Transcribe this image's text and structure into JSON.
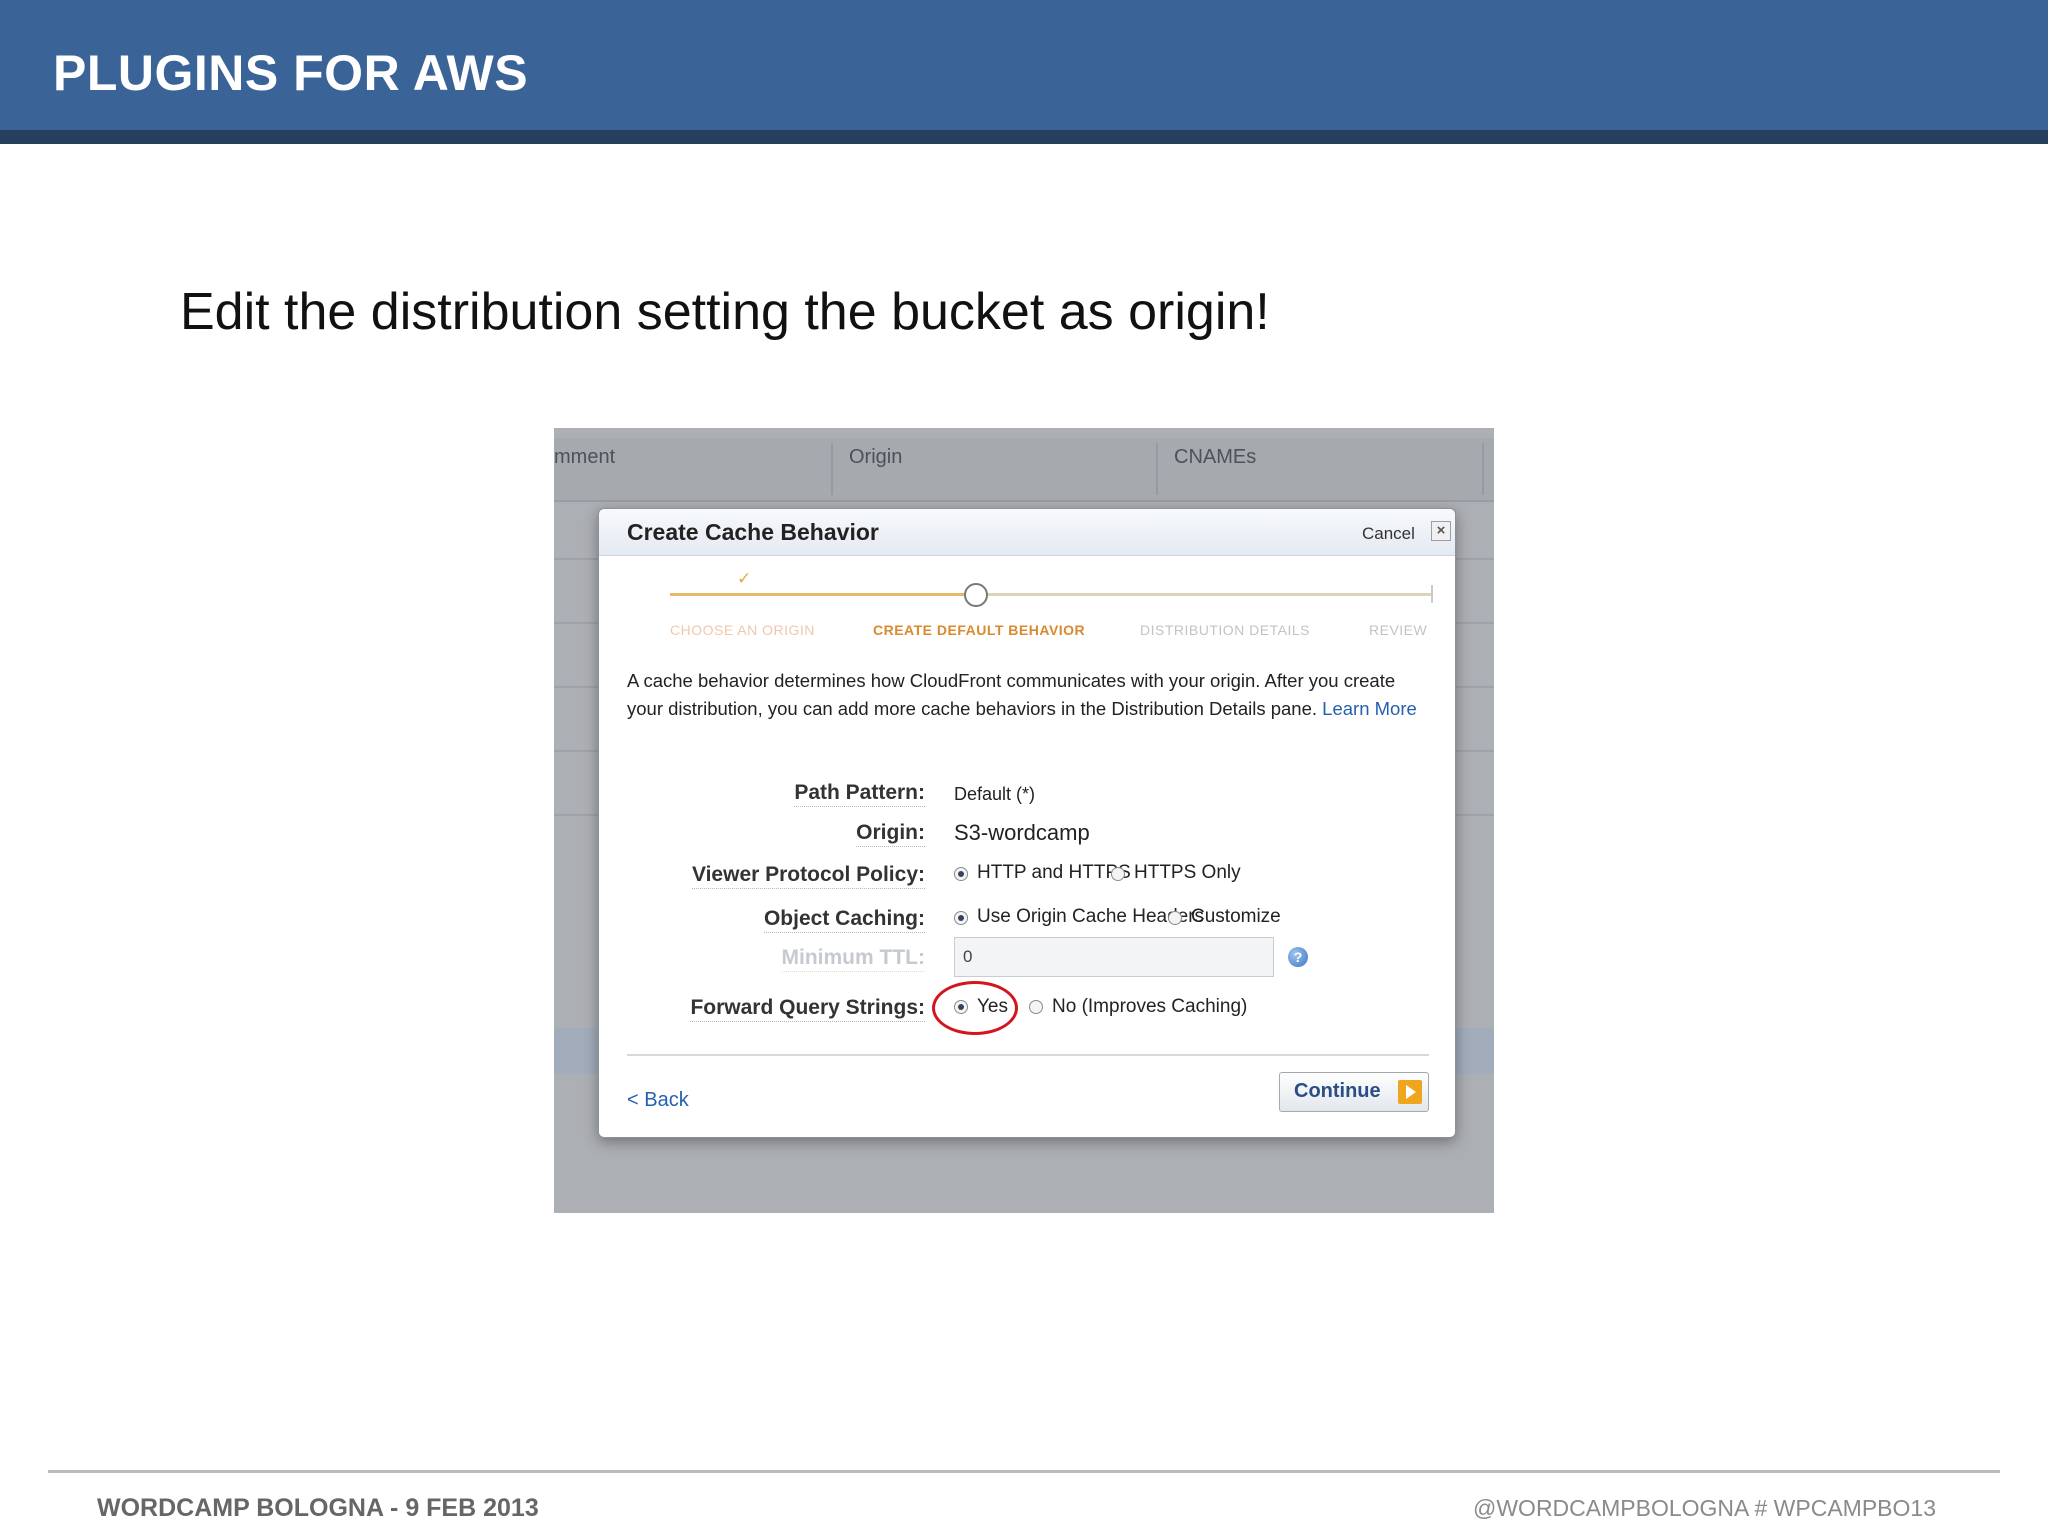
{
  "slide": {
    "title": "PLUGINS FOR AWS",
    "subtitle": "Edit the distribution setting the bucket as origin!",
    "footer_left": "WORDCAMP BOLOGNA - 9 FEB 2013",
    "footer_right": "@WORDCAMPBOLOGNA # WPCAMPBO13"
  },
  "background_table": {
    "columns": [
      "mment",
      "Origin",
      "CNAMEs"
    ]
  },
  "dialog": {
    "title": "Create Cache Behavior",
    "cancel_label": "Cancel",
    "close_icon": "×",
    "steps": [
      "CHOOSE AN ORIGIN",
      "CREATE DEFAULT BEHAVIOR",
      "DISTRIBUTION DETAILS",
      "REVIEW"
    ],
    "current_step": 2,
    "description": "A cache behavior determines how CloudFront communicates with your origin. After you create your distribution, you can add more cache behaviors in the Distribution Details pane.",
    "learn_more": "Learn More",
    "fields": {
      "path_pattern": {
        "label": "Path Pattern:",
        "value": "Default (*)"
      },
      "origin": {
        "label": "Origin:",
        "value": "S3-wordcamp"
      },
      "viewer_protocol_policy": {
        "label": "Viewer Protocol Policy:",
        "options": [
          "HTTP and HTTPS",
          "HTTPS Only"
        ],
        "selected": "HTTP and HTTPS"
      },
      "object_caching": {
        "label": "Object Caching:",
        "options": [
          "Use Origin Cache Headers",
          "Customize"
        ],
        "selected": "Use Origin Cache Headers"
      },
      "minimum_ttl": {
        "label": "Minimum TTL:",
        "value": "0",
        "help_icon": "?"
      },
      "forward_query_strings": {
        "label": "Forward Query Strings:",
        "options": [
          "Yes",
          "No (Improves Caching)"
        ],
        "selected": "Yes"
      }
    },
    "back_label": "< Back",
    "continue_label": "Continue"
  },
  "colors": {
    "header_blue": "#3a6497",
    "link_blue": "#2560b0",
    "active_step_orange": "#d9892e",
    "highlight_red": "#d4151d"
  }
}
